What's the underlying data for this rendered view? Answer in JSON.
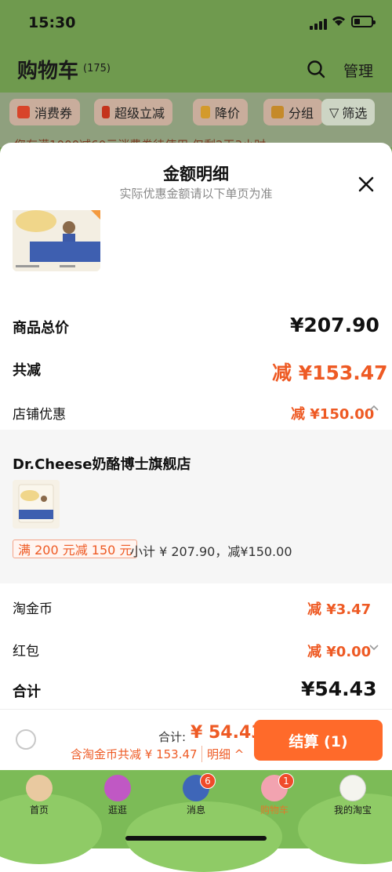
{
  "status_bar": {
    "time": "15:30"
  },
  "background": {
    "title": "购物车",
    "count": "(175)",
    "manage_label": "管理",
    "chips": [
      "消费券",
      "超级立减",
      "降价",
      "分组",
      "筛选"
    ],
    "notice": "您有满1000减60元消费券待使用 仅剩2天3小时"
  },
  "sheet": {
    "title": "金额明细",
    "subtitle": "实际优惠金额请以下单页为准",
    "rows": {
      "goods_total": {
        "label": "商品总价",
        "value": "¥207.90"
      },
      "total_discount": {
        "label": "共减",
        "value": "减 ¥153.47"
      },
      "shop_discount": {
        "label": "店铺优惠",
        "value": "减 ¥150.00"
      },
      "taojinbi": {
        "label": "淘金币",
        "value": "减 ¥3.47"
      },
      "hongbao": {
        "label": "红包",
        "value": "减 ¥0.00"
      },
      "total": {
        "label": "合计",
        "value": "¥54.43"
      }
    },
    "shop": {
      "name": "Dr.Cheese奶酪博士旗舰店",
      "promo_tag": "满 200 元减 150 元",
      "subtotal": "小计 ¥ 207.90，减¥150.00"
    }
  },
  "footer": {
    "total_label": "合计:",
    "total_value": "¥ 54.43",
    "coin_note": "含淘金币共减 ¥ 153.47",
    "detail_link": "明细",
    "checkout_label": "结算 (1)"
  },
  "tabbar": {
    "items": [
      {
        "label": "首页"
      },
      {
        "label": "逛逛"
      },
      {
        "label": "消息",
        "badge": "6"
      },
      {
        "label": "购物车",
        "badge": "1"
      },
      {
        "label": "我的淘宝"
      }
    ]
  },
  "colors": {
    "accent": "#ee5a24",
    "checkout": "#ff6a2a",
    "tabbar": "#7cbb57"
  },
  "icons": [
    "search-icon",
    "close-icon",
    "chevron-up-icon",
    "chevron-down-icon",
    "signal-icon",
    "wifi-icon",
    "battery-icon",
    "filter-icon"
  ]
}
